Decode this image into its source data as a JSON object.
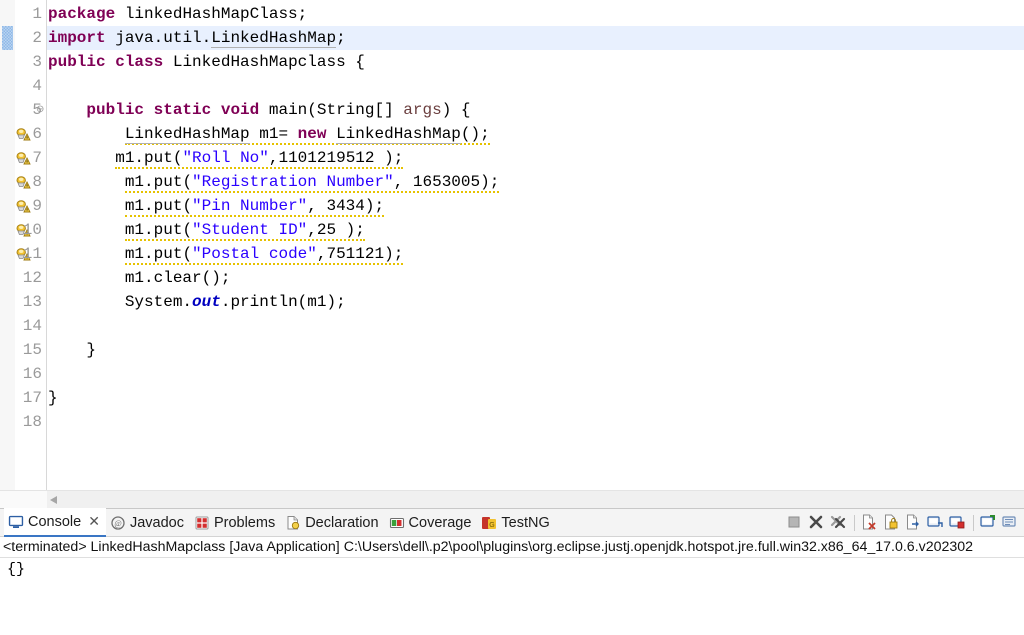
{
  "editor": {
    "highlighted_line": 2,
    "change_marker_line": 2,
    "colors": {
      "keyword": "#7f0055",
      "string": "#2a00ff",
      "static_field": "#0000c0",
      "parameter": "#6a3e3e",
      "line_number": "#9a9a9a",
      "highlight_row": "#e8f0fe",
      "warning_squiggle": "#e6c200"
    },
    "lines": [
      {
        "n": "1",
        "fold": false,
        "warn": false,
        "text": "package linkedHashMapClass;"
      },
      {
        "n": "2",
        "fold": false,
        "warn": false,
        "text": "import java.util.LinkedHashMap;"
      },
      {
        "n": "3",
        "fold": false,
        "warn": false,
        "text": "public class LinkedHashMapclass {"
      },
      {
        "n": "4",
        "fold": false,
        "warn": false,
        "text": ""
      },
      {
        "n": "5",
        "fold": true,
        "warn": false,
        "text": "    public static void main(String[] args) {"
      },
      {
        "n": "6",
        "fold": false,
        "warn": true,
        "text": "        LinkedHashMap m1= new LinkedHashMap();"
      },
      {
        "n": "7",
        "fold": false,
        "warn": true,
        "text": "       m1.put(\"Roll No\",1101219512 );"
      },
      {
        "n": "8",
        "fold": false,
        "warn": true,
        "text": "        m1.put(\"Registration Number\", 1653005);"
      },
      {
        "n": "9",
        "fold": false,
        "warn": true,
        "text": "        m1.put(\"Pin Number\", 3434);"
      },
      {
        "n": "10",
        "fold": false,
        "warn": true,
        "text": "        m1.put(\"Student ID\",25 );"
      },
      {
        "n": "11",
        "fold": false,
        "warn": true,
        "text": "        m1.put(\"Postal code\",751121);"
      },
      {
        "n": "12",
        "fold": false,
        "warn": false,
        "text": "        m1.clear();"
      },
      {
        "n": "13",
        "fold": false,
        "warn": false,
        "text": "        System.out.println(m1);"
      },
      {
        "n": "14",
        "fold": false,
        "warn": false,
        "text": ""
      },
      {
        "n": "15",
        "fold": false,
        "warn": false,
        "text": "    }"
      },
      {
        "n": "16",
        "fold": false,
        "warn": false,
        "text": ""
      },
      {
        "n": "17",
        "fold": false,
        "warn": false,
        "text": "}"
      },
      {
        "n": "18",
        "fold": false,
        "warn": false,
        "text": ""
      }
    ],
    "fold_glyph": "⊖"
  },
  "panel": {
    "tabs": [
      {
        "label": "Console",
        "icon": "console-icon",
        "active": true,
        "closable": true,
        "close_glyph": "✕"
      },
      {
        "label": "Javadoc",
        "icon": "javadoc-icon",
        "active": false,
        "closable": false
      },
      {
        "label": "Problems",
        "icon": "problems-icon",
        "active": false,
        "closable": false
      },
      {
        "label": "Declaration",
        "icon": "declaration-icon",
        "active": false,
        "closable": false
      },
      {
        "label": "Coverage",
        "icon": "coverage-icon",
        "active": false,
        "closable": false
      },
      {
        "label": "TestNG",
        "icon": "testng-icon",
        "active": false,
        "closable": false
      }
    ],
    "toolbar_buttons": [
      "terminate-button",
      "remove-launch-button",
      "remove-all-terminated-button",
      "clear-console-button",
      "scroll-lock-button",
      "word-wrap-button",
      "pin-console-button",
      "display-selected-console-button",
      "open-console-button",
      "view-menu-button"
    ],
    "console_header": "<terminated> LinkedHashMapclass [Java Application] C:\\Users\\dell\\.p2\\pool\\plugins\\org.eclipse.justj.openjdk.hotspot.jre.full.win32.x86_64_17.0.6.v202302",
    "console_output": [
      "{}"
    ]
  }
}
